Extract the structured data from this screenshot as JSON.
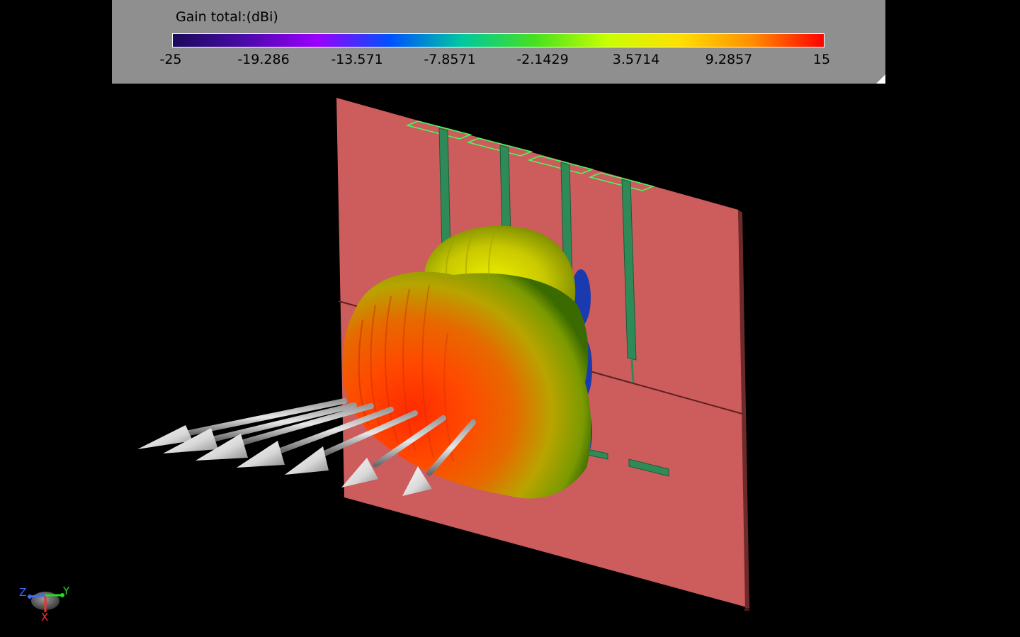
{
  "legend": {
    "title": "Gain total:(dBi)",
    "ticks": [
      "-25",
      "-19.286",
      "-13.571",
      "-7.8571",
      "-2.1429",
      "3.5714",
      "9.2857",
      "15"
    ],
    "min": -25,
    "max": 15,
    "colormap": [
      "#1a0a5a",
      "#4a0aa8",
      "#9a00ff",
      "#0050ff",
      "#00c8a0",
      "#46e020",
      "#c8ff00",
      "#ffe000",
      "#ff9000",
      "#ff0000"
    ]
  },
  "axes_triad": {
    "x_label": "X",
    "y_label": "Y",
    "z_label": "Z",
    "x_color": "#ff2a2a",
    "y_color": "#20e020",
    "z_color": "#3a6cff"
  },
  "colors": {
    "background": "#000000",
    "legend_panel": "#8f8f8f",
    "ground_plane": "#cd5c5c",
    "microstrip": "#2e8b57",
    "patch_outline": "#40ff60",
    "arrow": "#d0d0d0"
  }
}
